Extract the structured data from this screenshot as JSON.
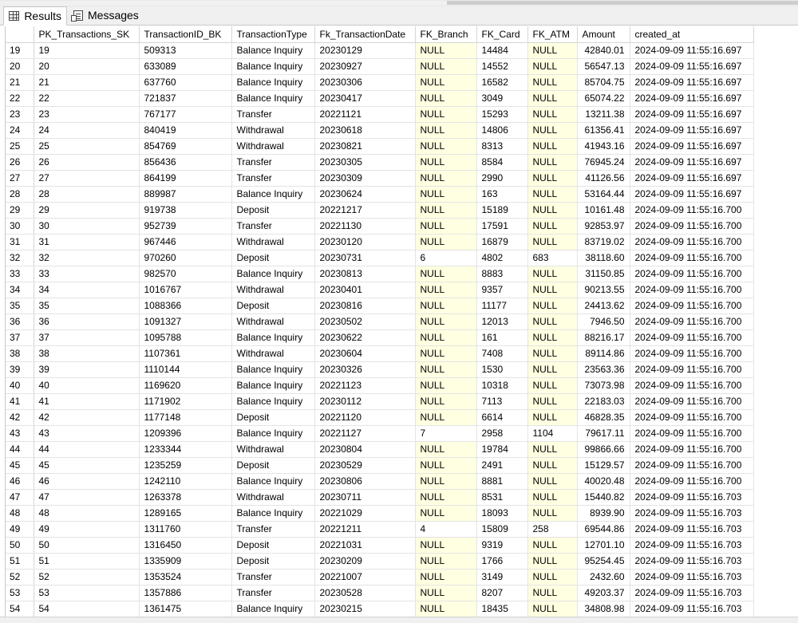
{
  "tabs": [
    {
      "label": "Results",
      "icon": "grid-icon"
    },
    {
      "label": "Messages",
      "icon": "messages-icon"
    }
  ],
  "columns": [
    "PK_Transactions_SK",
    "TransactionID_BK",
    "TransactionType",
    "Fk_TransactionDate",
    "FK_Branch",
    "FK_Card",
    "FK_ATM",
    "Amount",
    "created_at"
  ],
  "rows": [
    [
      "19",
      "19",
      "509313",
      "Balance Inquiry",
      "20230129",
      "NULL",
      "14484",
      "NULL",
      "42840.01",
      "2024-09-09 11:55:16.697"
    ],
    [
      "20",
      "20",
      "633089",
      "Balance Inquiry",
      "20230927",
      "NULL",
      "14552",
      "NULL",
      "56547.13",
      "2024-09-09 11:55:16.697"
    ],
    [
      "21",
      "21",
      "637760",
      "Balance Inquiry",
      "20230306",
      "NULL",
      "16582",
      "NULL",
      "85704.75",
      "2024-09-09 11:55:16.697"
    ],
    [
      "22",
      "22",
      "721837",
      "Balance Inquiry",
      "20230417",
      "NULL",
      "3049",
      "NULL",
      "65074.22",
      "2024-09-09 11:55:16.697"
    ],
    [
      "23",
      "23",
      "767177",
      "Transfer",
      "20221121",
      "NULL",
      "15293",
      "NULL",
      "13211.38",
      "2024-09-09 11:55:16.697"
    ],
    [
      "24",
      "24",
      "840419",
      "Withdrawal",
      "20230618",
      "NULL",
      "14806",
      "NULL",
      "61356.41",
      "2024-09-09 11:55:16.697"
    ],
    [
      "25",
      "25",
      "854769",
      "Withdrawal",
      "20230821",
      "NULL",
      "8313",
      "NULL",
      "41943.16",
      "2024-09-09 11:55:16.697"
    ],
    [
      "26",
      "26",
      "856436",
      "Transfer",
      "20230305",
      "NULL",
      "8584",
      "NULL",
      "76945.24",
      "2024-09-09 11:55:16.697"
    ],
    [
      "27",
      "27",
      "864199",
      "Transfer",
      "20230309",
      "NULL",
      "2990",
      "NULL",
      "41126.56",
      "2024-09-09 11:55:16.697"
    ],
    [
      "28",
      "28",
      "889987",
      "Balance Inquiry",
      "20230624",
      "NULL",
      "163",
      "NULL",
      "53164.44",
      "2024-09-09 11:55:16.697"
    ],
    [
      "29",
      "29",
      "919738",
      "Deposit",
      "20221217",
      "NULL",
      "15189",
      "NULL",
      "10161.48",
      "2024-09-09 11:55:16.700"
    ],
    [
      "30",
      "30",
      "952739",
      "Transfer",
      "20221130",
      "NULL",
      "17591",
      "NULL",
      "92853.97",
      "2024-09-09 11:55:16.700"
    ],
    [
      "31",
      "31",
      "967446",
      "Withdrawal",
      "20230120",
      "NULL",
      "16879",
      "NULL",
      "83719.02",
      "2024-09-09 11:55:16.700"
    ],
    [
      "32",
      "32",
      "970260",
      "Deposit",
      "20230731",
      "6",
      "4802",
      "683",
      "38118.60",
      "2024-09-09 11:55:16.700"
    ],
    [
      "33",
      "33",
      "982570",
      "Balance Inquiry",
      "20230813",
      "NULL",
      "8883",
      "NULL",
      "31150.85",
      "2024-09-09 11:55:16.700"
    ],
    [
      "34",
      "34",
      "1016767",
      "Withdrawal",
      "20230401",
      "NULL",
      "9357",
      "NULL",
      "90213.55",
      "2024-09-09 11:55:16.700"
    ],
    [
      "35",
      "35",
      "1088366",
      "Deposit",
      "20230816",
      "NULL",
      "11177",
      "NULL",
      "24413.62",
      "2024-09-09 11:55:16.700"
    ],
    [
      "36",
      "36",
      "1091327",
      "Withdrawal",
      "20230502",
      "NULL",
      "12013",
      "NULL",
      "7946.50",
      "2024-09-09 11:55:16.700"
    ],
    [
      "37",
      "37",
      "1095788",
      "Balance Inquiry",
      "20230622",
      "NULL",
      "161",
      "NULL",
      "88216.17",
      "2024-09-09 11:55:16.700"
    ],
    [
      "38",
      "38",
      "1107361",
      "Withdrawal",
      "20230604",
      "NULL",
      "7408",
      "NULL",
      "89114.86",
      "2024-09-09 11:55:16.700"
    ],
    [
      "39",
      "39",
      "1110144",
      "Balance Inquiry",
      "20230326",
      "NULL",
      "1530",
      "NULL",
      "23563.36",
      "2024-09-09 11:55:16.700"
    ],
    [
      "40",
      "40",
      "1169620",
      "Balance Inquiry",
      "20221123",
      "NULL",
      "10318",
      "NULL",
      "73073.98",
      "2024-09-09 11:55:16.700"
    ],
    [
      "41",
      "41",
      "1171902",
      "Balance Inquiry",
      "20230112",
      "NULL",
      "7113",
      "NULL",
      "22183.03",
      "2024-09-09 11:55:16.700"
    ],
    [
      "42",
      "42",
      "1177148",
      "Deposit",
      "20221120",
      "NULL",
      "6614",
      "NULL",
      "46828.35",
      "2024-09-09 11:55:16.700"
    ],
    [
      "43",
      "43",
      "1209396",
      "Balance Inquiry",
      "20221127",
      "7",
      "2958",
      "1104",
      "79617.11",
      "2024-09-09 11:55:16.700"
    ],
    [
      "44",
      "44",
      "1233344",
      "Withdrawal",
      "20230804",
      "NULL",
      "19784",
      "NULL",
      "99866.66",
      "2024-09-09 11:55:16.700"
    ],
    [
      "45",
      "45",
      "1235259",
      "Deposit",
      "20230529",
      "NULL",
      "2491",
      "NULL",
      "15129.57",
      "2024-09-09 11:55:16.700"
    ],
    [
      "46",
      "46",
      "1242110",
      "Balance Inquiry",
      "20230806",
      "NULL",
      "8881",
      "NULL",
      "40020.48",
      "2024-09-09 11:55:16.700"
    ],
    [
      "47",
      "47",
      "1263378",
      "Withdrawal",
      "20230711",
      "NULL",
      "8531",
      "NULL",
      "15440.82",
      "2024-09-09 11:55:16.703"
    ],
    [
      "48",
      "48",
      "1289165",
      "Balance Inquiry",
      "20221029",
      "NULL",
      "18093",
      "NULL",
      "8939.90",
      "2024-09-09 11:55:16.703"
    ],
    [
      "49",
      "49",
      "1311760",
      "Transfer",
      "20221211",
      "4",
      "15809",
      "258",
      "69544.86",
      "2024-09-09 11:55:16.703"
    ],
    [
      "50",
      "50",
      "1316450",
      "Deposit",
      "20221031",
      "NULL",
      "9319",
      "NULL",
      "12701.10",
      "2024-09-09 11:55:16.703"
    ],
    [
      "51",
      "51",
      "1335909",
      "Deposit",
      "20230209",
      "NULL",
      "1766",
      "NULL",
      "95254.45",
      "2024-09-09 11:55:16.703"
    ],
    [
      "52",
      "52",
      "1353524",
      "Transfer",
      "20221007",
      "NULL",
      "3149",
      "NULL",
      "2432.60",
      "2024-09-09 11:55:16.703"
    ],
    [
      "53",
      "53",
      "1357886",
      "Transfer",
      "20230528",
      "NULL",
      "8207",
      "NULL",
      "49203.37",
      "2024-09-09 11:55:16.703"
    ],
    [
      "54",
      "54",
      "1361475",
      "Balance Inquiry",
      "20230215",
      "NULL",
      "18435",
      "NULL",
      "34808.98",
      "2024-09-09 11:55:16.703"
    ]
  ],
  "colors": {
    "null_cell_bg": "#ffffe1",
    "grid_line": "#e4e4e4"
  }
}
